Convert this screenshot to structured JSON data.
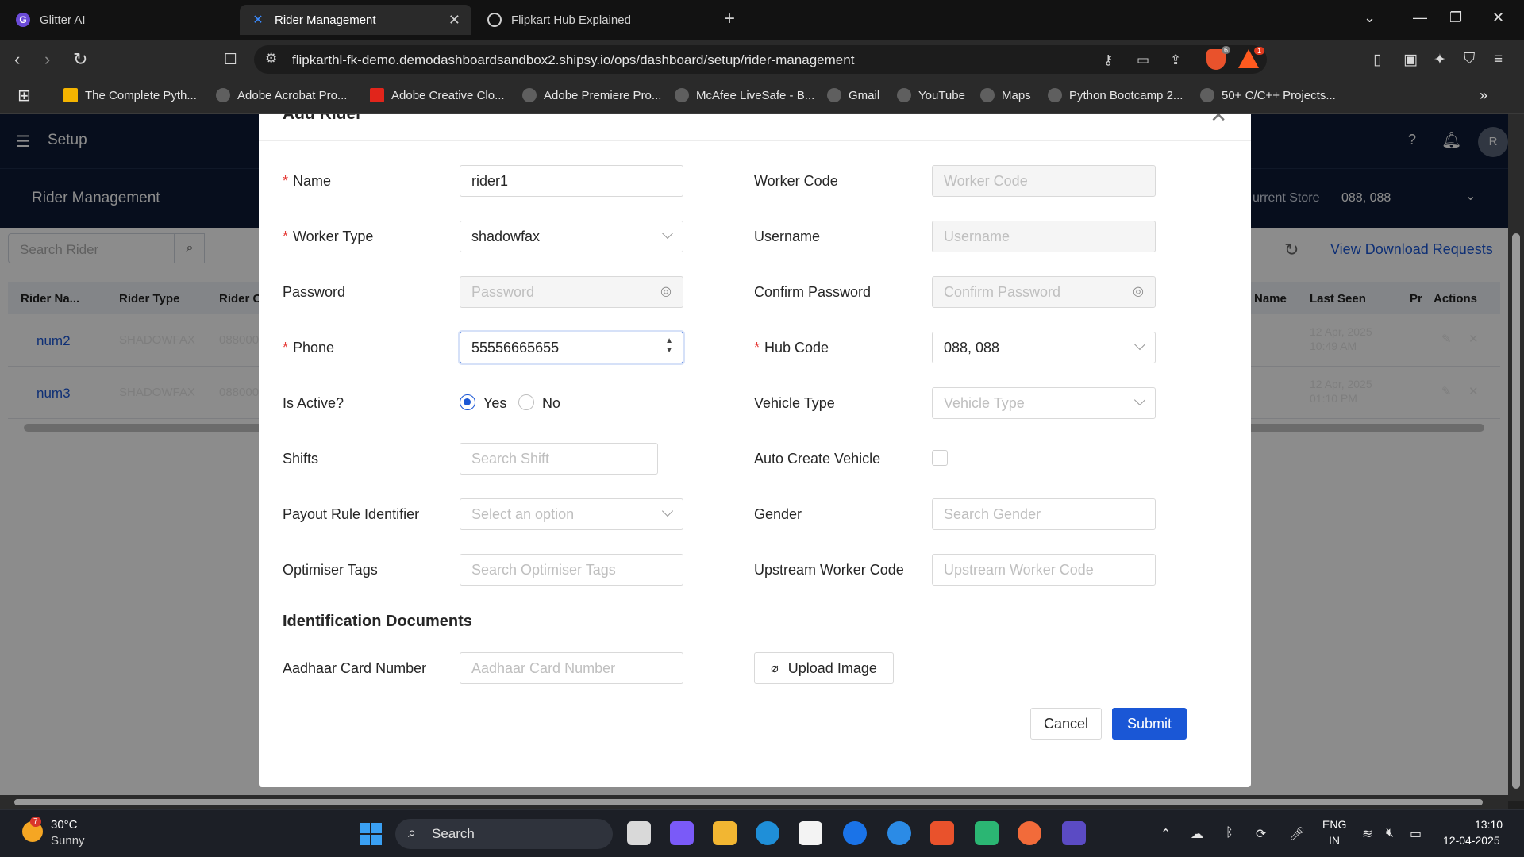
{
  "browser": {
    "tabs": [
      {
        "title": "Glitter AI",
        "active": false
      },
      {
        "title": "Rider Management",
        "active": true
      },
      {
        "title": "Flipkart Hub Explained",
        "active": false
      }
    ],
    "url": "flipkarthl-fk-demo.demodashboardsandbox2.shipsy.io/ops/dashboard/setup/rider-management",
    "shield_count": "6",
    "rewards_count": "1",
    "bookmarks": [
      "The Complete Pyth...",
      "Adobe Acrobat Pro...",
      "Adobe Creative Clo...",
      "Adobe Premiere Pro...",
      "McAfee LiveSafe - B...",
      "Gmail",
      "YouTube",
      "Maps",
      "Python Bootcamp 2...",
      "50+ C/C++ Projects..."
    ]
  },
  "app": {
    "header_title": "Setup",
    "avatar_initial": "R",
    "page_title": "Rider Management",
    "current_store_label": "urrent Store",
    "current_store_value": "088, 088",
    "search_placeholder": "Search Rider",
    "view_download_requests": "View Download Requests",
    "columns": [
      "Rider Na...",
      "Rider Type",
      "Rider C",
      "Name",
      "Last Seen",
      "Pr",
      "Actions"
    ],
    "rows": [
      {
        "name": "num2",
        "type": "SHADOWFAX",
        "code": "088000",
        "last_seen_date": "12 Apr, 2025",
        "last_seen_time": "10:49 AM"
      },
      {
        "name": "num3",
        "type": "SHADOWFAX",
        "code": "088000",
        "last_seen_date": "12 Apr, 2025",
        "last_seen_time": "01:10 PM"
      }
    ]
  },
  "modal": {
    "title": "Add Rider",
    "fields": {
      "name": {
        "label": "Name",
        "value": "rider1"
      },
      "worker_code": {
        "label": "Worker Code",
        "placeholder": "Worker Code"
      },
      "worker_type": {
        "label": "Worker Type",
        "value": "shadowfax"
      },
      "username": {
        "label": "Username",
        "placeholder": "Username"
      },
      "password": {
        "label": "Password",
        "placeholder": "Password"
      },
      "confirm_password": {
        "label": "Confirm Password",
        "placeholder": "Confirm Password"
      },
      "phone": {
        "label": "Phone",
        "value": "55556665655"
      },
      "hub_code": {
        "label": "Hub Code",
        "value": "088, 088"
      },
      "is_active": {
        "label": "Is Active?",
        "yes": "Yes",
        "no": "No",
        "selected": "Yes"
      },
      "vehicle_type": {
        "label": "Vehicle Type",
        "placeholder": "Vehicle Type"
      },
      "shifts": {
        "label": "Shifts",
        "placeholder": "Search Shift"
      },
      "auto_create_vehicle": {
        "label": "Auto Create Vehicle",
        "checked": false
      },
      "payout_rule": {
        "label": "Payout Rule Identifier",
        "placeholder": "Select an option"
      },
      "gender": {
        "label": "Gender",
        "placeholder": "Search Gender"
      },
      "optimiser_tags": {
        "label": "Optimiser Tags",
        "placeholder": "Search Optimiser Tags"
      },
      "upstream_worker_code": {
        "label": "Upstream Worker Code",
        "placeholder": "Upstream Worker Code"
      }
    },
    "identification": {
      "title": "Identification Documents",
      "aadhaar_label": "Aadhaar Card Number",
      "aadhaar_placeholder": "Aadhaar Card Number",
      "upload_label": "Upload Image"
    },
    "cancel_label": "Cancel",
    "submit_label": "Submit"
  },
  "taskbar": {
    "weather_temp": "30°C",
    "weather_desc": "Sunny",
    "weather_badge": "7",
    "search_label": "Search",
    "lang_top": "ENG",
    "lang_bottom": "IN",
    "time": "13:10",
    "date": "12-04-2025"
  },
  "colors": {
    "primary": "#1a57d6",
    "app_header": "#0d1b35",
    "required": "#e53935",
    "brave": "#e9522c"
  }
}
